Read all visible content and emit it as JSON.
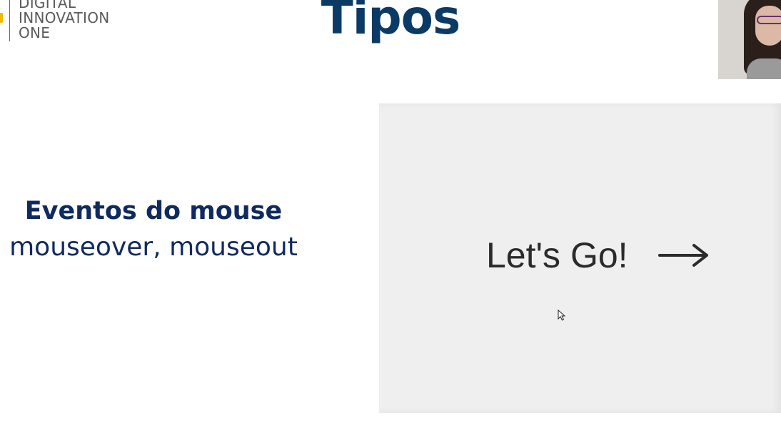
{
  "brand": {
    "lines": [
      "DIGITAL",
      "INNOVATION",
      "ONE"
    ],
    "accent_color": "#f2b900"
  },
  "slide": {
    "title": "Tipos",
    "title_color": "#0c3a66"
  },
  "content": {
    "heading": "Eventos do mouse",
    "events": "mouseover, mouseout",
    "text_color": "#0f2a5e"
  },
  "demo": {
    "button_label": "Let's Go!",
    "arrow_icon": "long-right-arrow-icon",
    "panel_color": "#efefef"
  },
  "overlay": {
    "cursor_icon": "mouse-pointer-icon",
    "webcam": "presenter-webcam"
  }
}
